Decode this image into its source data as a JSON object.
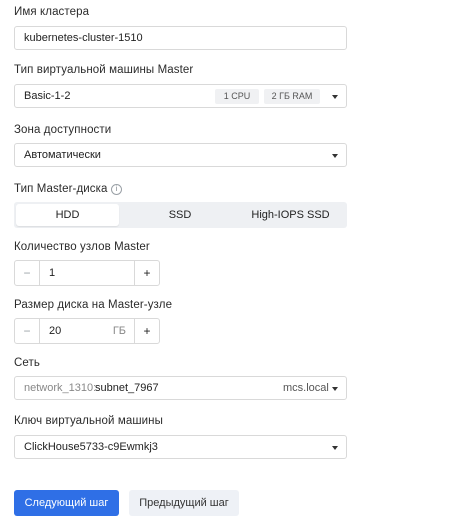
{
  "cluster_name": {
    "label": "Имя кластера",
    "value": "kubernetes-cluster-1510"
  },
  "vm_type": {
    "label": "Тип виртуальной машины Master",
    "value": "Basic-1-2",
    "cpu_chip": "1 CPU",
    "ram_chip": "2 ГБ RAM"
  },
  "zone": {
    "label": "Зона доступности",
    "value": "Автоматически"
  },
  "disk_type": {
    "label": "Тип Master-диска",
    "options": [
      "HDD",
      "SSD",
      "High-IOPS SSD"
    ],
    "selected": "HDD"
  },
  "node_count": {
    "label": "Количество узлов Master",
    "value": "1",
    "minus": "−",
    "plus": "+"
  },
  "disk_size": {
    "label": "Размер диска на Master-узле",
    "value": "20",
    "unit": "ГБ",
    "minus": "−",
    "plus": "+"
  },
  "network": {
    "label": "Сеть",
    "network_name": "network_1310:",
    "subnet": "subnet_7967",
    "domain": "mcs.local"
  },
  "vm_key": {
    "label": "Ключ виртуальной машины",
    "value": "ClickHouse5733-c9Ewmkj3"
  },
  "actions": {
    "next_label": "Следующий шаг",
    "prev_label": "Предыдущий шаг"
  },
  "icons": {
    "info": "info-icon",
    "dropdown": "chevron-down-icon"
  },
  "colors": {
    "primary": "#2f6fe6",
    "secondary_bg": "#eef1f6",
    "border": "#d9d9d9"
  }
}
